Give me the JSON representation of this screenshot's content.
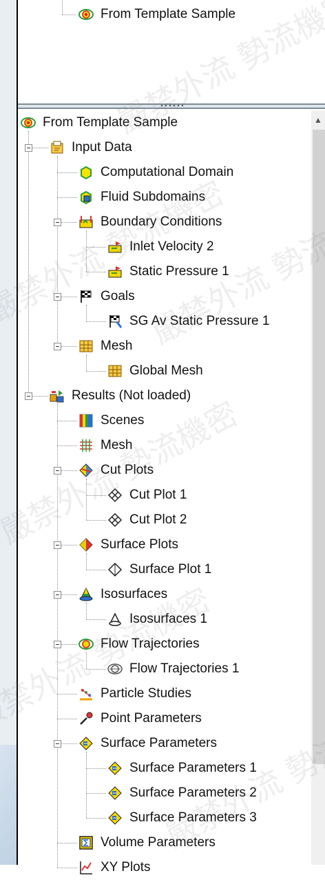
{
  "top_pane": {
    "item_label": "From Template Sample"
  },
  "tree": {
    "items": [
      {
        "label": "From Template Sample",
        "icon": "eye-icon",
        "level": 0,
        "expander": false
      },
      {
        "label": "Input Data",
        "icon": "input-data-icon",
        "level": 1,
        "expander": true
      },
      {
        "label": "Computational Domain",
        "icon": "cube-icon",
        "level": 2,
        "expander": false
      },
      {
        "label": "Fluid Subdomains",
        "icon": "fluid-subdomain-icon",
        "level": 2,
        "expander": false
      },
      {
        "label": "Boundary Conditions",
        "icon": "boundary-conditions-icon",
        "level": 2,
        "expander": true
      },
      {
        "label": "Inlet Velocity 2",
        "icon": "boundary-condition-icon",
        "level": 3,
        "expander": false
      },
      {
        "label": "Static Pressure 1",
        "icon": "boundary-condition-icon",
        "level": 3,
        "expander": false
      },
      {
        "label": "Goals",
        "icon": "goals-flag-icon",
        "level": 2,
        "expander": true
      },
      {
        "label": "SG Av Static Pressure 1",
        "icon": "goal-flag-icon",
        "level": 3,
        "expander": false
      },
      {
        "label": "Mesh",
        "icon": "mesh-folder-icon",
        "level": 2,
        "expander": true
      },
      {
        "label": "Global Mesh",
        "icon": "global-mesh-icon",
        "level": 3,
        "expander": false
      },
      {
        "label": "Results (Not loaded)",
        "icon": "results-icon",
        "level": 1,
        "expander": true
      },
      {
        "label": "Scenes",
        "icon": "scenes-icon",
        "level": 2,
        "expander": false
      },
      {
        "label": "Mesh",
        "icon": "mesh-grid-icon",
        "level": 2,
        "expander": false
      },
      {
        "label": "Cut Plots",
        "icon": "cut-plots-icon",
        "level": 2,
        "expander": true
      },
      {
        "label": "Cut Plot 1",
        "icon": "cut-plot-icon",
        "level": 3,
        "expander": false
      },
      {
        "label": "Cut Plot 2",
        "icon": "cut-plot-icon",
        "level": 3,
        "expander": false
      },
      {
        "label": "Surface Plots",
        "icon": "surface-plots-icon",
        "level": 2,
        "expander": true
      },
      {
        "label": "Surface Plot 1",
        "icon": "surface-plot-icon",
        "level": 3,
        "expander": false
      },
      {
        "label": "Isosurfaces",
        "icon": "isosurfaces-icon",
        "level": 2,
        "expander": true
      },
      {
        "label": "Isosurfaces 1",
        "icon": "isosurface-icon",
        "level": 3,
        "expander": false
      },
      {
        "label": "Flow Trajectories",
        "icon": "flow-trajectories-icon",
        "level": 2,
        "expander": true
      },
      {
        "label": "Flow Trajectories 1",
        "icon": "flow-trajectory-icon",
        "level": 3,
        "expander": false
      },
      {
        "label": "Particle Studies",
        "icon": "particle-studies-icon",
        "level": 2,
        "expander": false
      },
      {
        "label": "Point Parameters",
        "icon": "point-parameters-icon",
        "level": 2,
        "expander": false
      },
      {
        "label": "Surface Parameters",
        "icon": "surface-parameters-icon",
        "level": 2,
        "expander": true
      },
      {
        "label": "Surface Parameters 1",
        "icon": "surface-parameter-icon",
        "level": 3,
        "expander": false
      },
      {
        "label": "Surface Parameters 2",
        "icon": "surface-parameter-icon",
        "level": 3,
        "expander": false
      },
      {
        "label": "Surface Parameters 3",
        "icon": "surface-parameter-icon",
        "level": 3,
        "expander": false
      },
      {
        "label": "Volume Parameters",
        "icon": "volume-parameters-icon",
        "level": 2,
        "expander": false
      },
      {
        "label": "XY Plots",
        "icon": "xy-plots-icon",
        "level": 2,
        "expander": false
      }
    ]
  },
  "watermark": {
    "text": "嚴禁外流 勢流機密"
  },
  "colors": {
    "accent_yellow": "#f5d800",
    "accent_green": "#2e9b3a",
    "accent_blue": "#2a6fd6",
    "splitter": "#7f8b96"
  }
}
